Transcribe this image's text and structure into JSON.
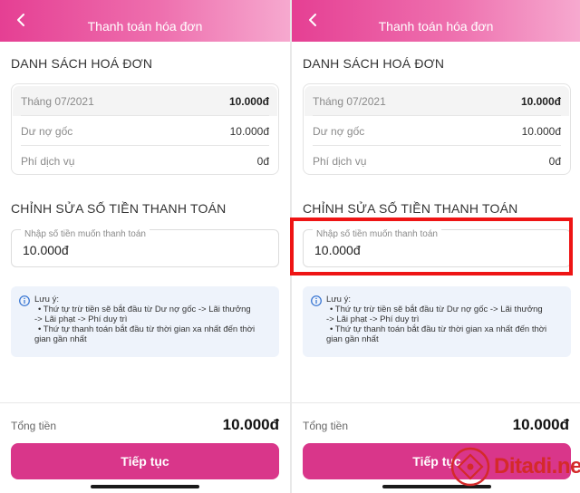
{
  "header": {
    "title": "Thanh toán hóa đơn"
  },
  "list_section": {
    "title": "DANH SÁCH HOÁ ĐƠN",
    "rows": [
      {
        "label": "Tháng 07/2021",
        "value": "10.000đ"
      },
      {
        "label": "Dư nợ gốc",
        "value": "10.000đ"
      },
      {
        "label": "Phí dịch vụ",
        "value": "0đ"
      }
    ]
  },
  "edit_section": {
    "title": "CHỈNH SỬA SỐ TIỀN THANH TOÁN",
    "input_placeholder": "Nhập số tiền muốn thanh toán",
    "input_value": "10.000đ"
  },
  "note": {
    "lines": [
      "Lưu ý:",
      "• Thứ tự trừ tiền sẽ bắt đầu từ Dư nợ gốc -> Lãi thưởng",
      "-> Lãi phạt -> Phí duy trì",
      "• Thứ tự thanh toán bắt đầu từ thời gian xa nhất đến thời",
      "gian gần nhất"
    ]
  },
  "total": {
    "label": "Tổng tiền",
    "value": "10.000đ"
  },
  "cta": {
    "label": "Tiếp tục"
  },
  "watermark": {
    "text": "Ditadi.net"
  },
  "colors": {
    "primary": "#d9368a",
    "highlight": "#ee1414",
    "note_bg": "#eef3fb"
  },
  "icons": {
    "back": "chevron-left-icon",
    "info": "info-icon"
  }
}
